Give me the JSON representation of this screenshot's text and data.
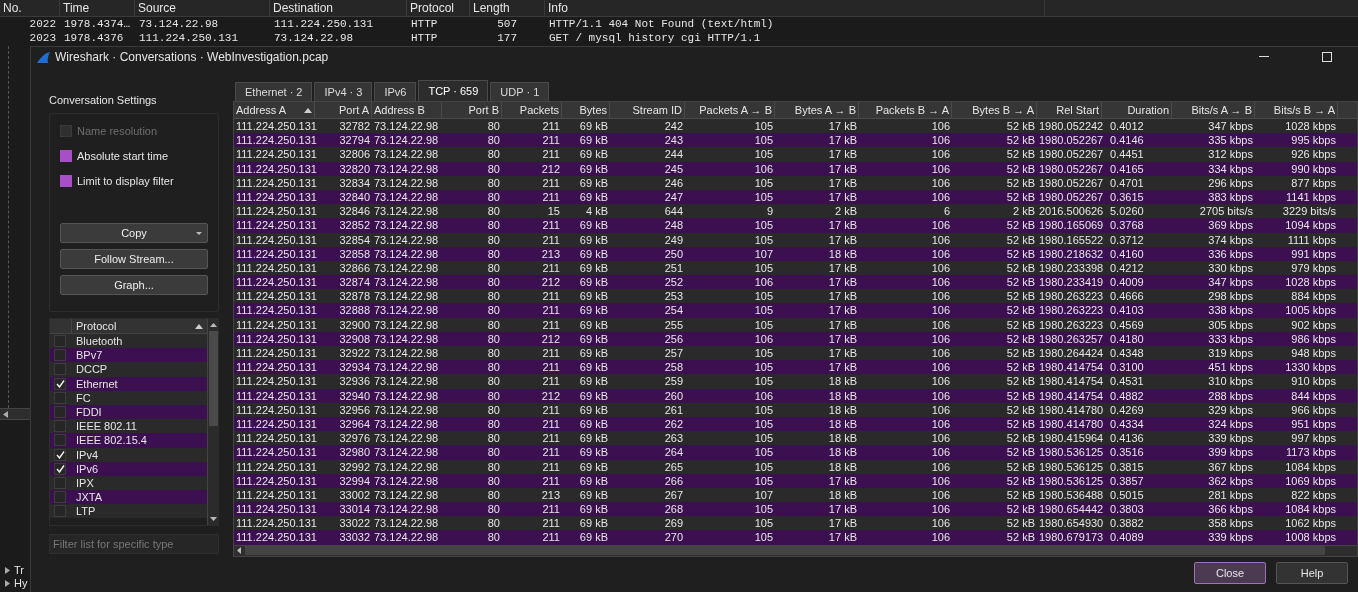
{
  "packet_list": {
    "columns": [
      "No.",
      "Time",
      "Source",
      "Destination",
      "Protocol",
      "Length",
      "Info"
    ],
    "rows": [
      [
        "2022",
        "1978.4374…",
        "73.124.22.98",
        "111.224.250.131",
        "HTTP",
        "507",
        "HTTP/1.1 404 Not Found  (text/html)"
      ],
      [
        "2023",
        "1978.4376",
        "111.224.250.131",
        "73.124.22.98",
        "HTTP",
        "177",
        "GET / mysql history cgi HTTP/1.1"
      ]
    ]
  },
  "details_tree": [
    {
      "label": "Tr",
      "expanded": false
    },
    {
      "label": "Hy",
      "expanded": false
    }
  ],
  "dialog": {
    "title": "Wireshark · Conversations · WebInvestigation.pcap",
    "settings": {
      "heading": "Conversation Settings",
      "options": [
        {
          "label": "Name resolution",
          "checked": false,
          "disabled": true
        },
        {
          "label": "Absolute start time",
          "checked": true,
          "disabled": false
        },
        {
          "label": "Limit to display filter",
          "checked": true,
          "disabled": false
        }
      ],
      "buttons": [
        {
          "label": "Copy",
          "menu": true
        },
        {
          "label": "Follow Stream...",
          "menu": false
        },
        {
          "label": "Graph...",
          "menu": false
        }
      ]
    },
    "protocols": {
      "header": "Protocol",
      "sorted": true,
      "items": [
        {
          "label": "Bluetooth",
          "checked": false
        },
        {
          "label": "BPv7",
          "checked": false
        },
        {
          "label": "DCCP",
          "checked": false
        },
        {
          "label": "Ethernet",
          "checked": true
        },
        {
          "label": "FC",
          "checked": false
        },
        {
          "label": "FDDI",
          "checked": false
        },
        {
          "label": "IEEE 802.11",
          "checked": false
        },
        {
          "label": "IEEE 802.15.4",
          "checked": false
        },
        {
          "label": "IPv4",
          "checked": true
        },
        {
          "label": "IPv6",
          "checked": true
        },
        {
          "label": "IPX",
          "checked": false
        },
        {
          "label": "JXTA",
          "checked": false
        },
        {
          "label": "LTP",
          "checked": false
        }
      ],
      "filter_placeholder": "Filter list for specific type"
    },
    "tabs": [
      {
        "label": "Ethernet · 2",
        "selected": false
      },
      {
        "label": "IPv4 · 3",
        "selected": false
      },
      {
        "label": "IPv6",
        "selected": false
      },
      {
        "label": "TCP · 659",
        "selected": true
      },
      {
        "label": "UDP · 1",
        "selected": false
      }
    ],
    "table": {
      "columns": [
        {
          "label": "Address A",
          "sorted": true
        },
        {
          "label": "Port A",
          "sorted": false
        },
        {
          "label": "Address B",
          "sorted": false
        },
        {
          "label": "Port B",
          "sorted": false
        },
        {
          "label": "Packets",
          "sorted": false
        },
        {
          "label": "Bytes",
          "sorted": false
        },
        {
          "label": "Stream ID",
          "sorted": false
        },
        {
          "label": "Packets A → B",
          "sorted": false
        },
        {
          "label": "Bytes A → B",
          "sorted": false
        },
        {
          "label": "Packets B → A",
          "sorted": false
        },
        {
          "label": "Bytes B → A",
          "sorted": false
        },
        {
          "label": "Rel Start",
          "sorted": false
        },
        {
          "label": "Duration",
          "sorted": false
        },
        {
          "label": "Bits/s A → B",
          "sorted": false
        },
        {
          "label": "Bits/s B → A",
          "sorted": false
        }
      ],
      "rows": [
        [
          "111.224.250.131",
          "32782",
          "73.124.22.98",
          "80",
          "211",
          "69 kB",
          "242",
          "105",
          "17 kB",
          "106",
          "52 kB",
          "1980.052242",
          "0.4012",
          "347 kbps",
          "1028 kbps"
        ],
        [
          "111.224.250.131",
          "32794",
          "73.124.22.98",
          "80",
          "211",
          "69 kB",
          "243",
          "105",
          "17 kB",
          "106",
          "52 kB",
          "1980.052267",
          "0.4146",
          "335 kbps",
          "995 kbps"
        ],
        [
          "111.224.250.131",
          "32806",
          "73.124.22.98",
          "80",
          "211",
          "69 kB",
          "244",
          "105",
          "17 kB",
          "106",
          "52 kB",
          "1980.052267",
          "0.4451",
          "312 kbps",
          "926 kbps"
        ],
        [
          "111.224.250.131",
          "32820",
          "73.124.22.98",
          "80",
          "212",
          "69 kB",
          "245",
          "106",
          "17 kB",
          "106",
          "52 kB",
          "1980.052267",
          "0.4165",
          "334 kbps",
          "990 kbps"
        ],
        [
          "111.224.250.131",
          "32834",
          "73.124.22.98",
          "80",
          "211",
          "69 kB",
          "246",
          "105",
          "17 kB",
          "106",
          "52 kB",
          "1980.052267",
          "0.4701",
          "296 kbps",
          "877 kbps"
        ],
        [
          "111.224.250.131",
          "32840",
          "73.124.22.98",
          "80",
          "211",
          "69 kB",
          "247",
          "105",
          "17 kB",
          "106",
          "52 kB",
          "1980.052267",
          "0.3615",
          "383 kbps",
          "1141 kbps"
        ],
        [
          "111.224.250.131",
          "32846",
          "73.124.22.98",
          "80",
          "15",
          "4 kB",
          "644",
          "9",
          "2 kB",
          "6",
          "2 kB",
          "2016.500626",
          "5.0260",
          "2705 bits/s",
          "3229 bits/s"
        ],
        [
          "111.224.250.131",
          "32852",
          "73.124.22.98",
          "80",
          "211",
          "69 kB",
          "248",
          "105",
          "17 kB",
          "106",
          "52 kB",
          "1980.165069",
          "0.3768",
          "369 kbps",
          "1094 kbps"
        ],
        [
          "111.224.250.131",
          "32854",
          "73.124.22.98",
          "80",
          "211",
          "69 kB",
          "249",
          "105",
          "17 kB",
          "106",
          "52 kB",
          "1980.165522",
          "0.3712",
          "374 kbps",
          "1111 kbps"
        ],
        [
          "111.224.250.131",
          "32858",
          "73.124.22.98",
          "80",
          "213",
          "69 kB",
          "250",
          "107",
          "18 kB",
          "106",
          "52 kB",
          "1980.218632",
          "0.4160",
          "336 kbps",
          "991 kbps"
        ],
        [
          "111.224.250.131",
          "32866",
          "73.124.22.98",
          "80",
          "211",
          "69 kB",
          "251",
          "105",
          "17 kB",
          "106",
          "52 kB",
          "1980.233398",
          "0.4212",
          "330 kbps",
          "979 kbps"
        ],
        [
          "111.224.250.131",
          "32874",
          "73.124.22.98",
          "80",
          "212",
          "69 kB",
          "252",
          "106",
          "17 kB",
          "106",
          "52 kB",
          "1980.233419",
          "0.4009",
          "347 kbps",
          "1028 kbps"
        ],
        [
          "111.224.250.131",
          "32878",
          "73.124.22.98",
          "80",
          "211",
          "69 kB",
          "253",
          "105",
          "17 kB",
          "106",
          "52 kB",
          "1980.263223",
          "0.4666",
          "298 kbps",
          "884 kbps"
        ],
        [
          "111.224.250.131",
          "32888",
          "73.124.22.98",
          "80",
          "211",
          "69 kB",
          "254",
          "105",
          "17 kB",
          "106",
          "52 kB",
          "1980.263223",
          "0.4103",
          "338 kbps",
          "1005 kbps"
        ],
        [
          "111.224.250.131",
          "32900",
          "73.124.22.98",
          "80",
          "211",
          "69 kB",
          "255",
          "105",
          "17 kB",
          "106",
          "52 kB",
          "1980.263223",
          "0.4569",
          "305 kbps",
          "902 kbps"
        ],
        [
          "111.224.250.131",
          "32908",
          "73.124.22.98",
          "80",
          "212",
          "69 kB",
          "256",
          "106",
          "17 kB",
          "106",
          "52 kB",
          "1980.263257",
          "0.4180",
          "333 kbps",
          "986 kbps"
        ],
        [
          "111.224.250.131",
          "32922",
          "73.124.22.98",
          "80",
          "211",
          "69 kB",
          "257",
          "105",
          "17 kB",
          "106",
          "52 kB",
          "1980.264424",
          "0.4348",
          "319 kbps",
          "948 kbps"
        ],
        [
          "111.224.250.131",
          "32934",
          "73.124.22.98",
          "80",
          "211",
          "69 kB",
          "258",
          "105",
          "17 kB",
          "106",
          "52 kB",
          "1980.414754",
          "0.3100",
          "451 kbps",
          "1330 kbps"
        ],
        [
          "111.224.250.131",
          "32936",
          "73.124.22.98",
          "80",
          "211",
          "69 kB",
          "259",
          "105",
          "18 kB",
          "106",
          "52 kB",
          "1980.414754",
          "0.4531",
          "310 kbps",
          "910 kbps"
        ],
        [
          "111.224.250.131",
          "32940",
          "73.124.22.98",
          "80",
          "212",
          "69 kB",
          "260",
          "106",
          "18 kB",
          "106",
          "52 kB",
          "1980.414754",
          "0.4882",
          "288 kbps",
          "844 kbps"
        ],
        [
          "111.224.250.131",
          "32956",
          "73.124.22.98",
          "80",
          "211",
          "69 kB",
          "261",
          "105",
          "18 kB",
          "106",
          "52 kB",
          "1980.414780",
          "0.4269",
          "329 kbps",
          "966 kbps"
        ],
        [
          "111.224.250.131",
          "32964",
          "73.124.22.98",
          "80",
          "211",
          "69 kB",
          "262",
          "105",
          "18 kB",
          "106",
          "52 kB",
          "1980.414780",
          "0.4334",
          "324 kbps",
          "951 kbps"
        ],
        [
          "111.224.250.131",
          "32976",
          "73.124.22.98",
          "80",
          "211",
          "69 kB",
          "263",
          "105",
          "18 kB",
          "106",
          "52 kB",
          "1980.415964",
          "0.4136",
          "339 kbps",
          "997 kbps"
        ],
        [
          "111.224.250.131",
          "32980",
          "73.124.22.98",
          "80",
          "211",
          "69 kB",
          "264",
          "105",
          "18 kB",
          "106",
          "52 kB",
          "1980.536125",
          "0.3516",
          "399 kbps",
          "1173 kbps"
        ],
        [
          "111.224.250.131",
          "32992",
          "73.124.22.98",
          "80",
          "211",
          "69 kB",
          "265",
          "105",
          "18 kB",
          "106",
          "52 kB",
          "1980.536125",
          "0.3815",
          "367 kbps",
          "1084 kbps"
        ],
        [
          "111.224.250.131",
          "32994",
          "73.124.22.98",
          "80",
          "211",
          "69 kB",
          "266",
          "105",
          "17 kB",
          "106",
          "52 kB",
          "1980.536125",
          "0.3857",
          "362 kbps",
          "1069 kbps"
        ],
        [
          "111.224.250.131",
          "33002",
          "73.124.22.98",
          "80",
          "213",
          "69 kB",
          "267",
          "107",
          "18 kB",
          "106",
          "52 kB",
          "1980.536488",
          "0.5015",
          "281 kbps",
          "822 kbps"
        ],
        [
          "111.224.250.131",
          "33014",
          "73.124.22.98",
          "80",
          "211",
          "69 kB",
          "268",
          "105",
          "17 kB",
          "106",
          "52 kB",
          "1980.654442",
          "0.3803",
          "366 kbps",
          "1084 kbps"
        ],
        [
          "111.224.250.131",
          "33022",
          "73.124.22.98",
          "80",
          "211",
          "69 kB",
          "269",
          "105",
          "17 kB",
          "106",
          "52 kB",
          "1980.654930",
          "0.3882",
          "358 kbps",
          "1062 kbps"
        ],
        [
          "111.224.250.131",
          "33032",
          "73.124.22.98",
          "80",
          "211",
          "69 kB",
          "270",
          "105",
          "17 kB",
          "106",
          "52 kB",
          "1980.679173",
          "0.4089",
          "339 kbps",
          "1008 kbps"
        ]
      ]
    },
    "footer_buttons": [
      {
        "label": "Close",
        "focused": true
      },
      {
        "label": "Help",
        "focused": false
      }
    ]
  }
}
